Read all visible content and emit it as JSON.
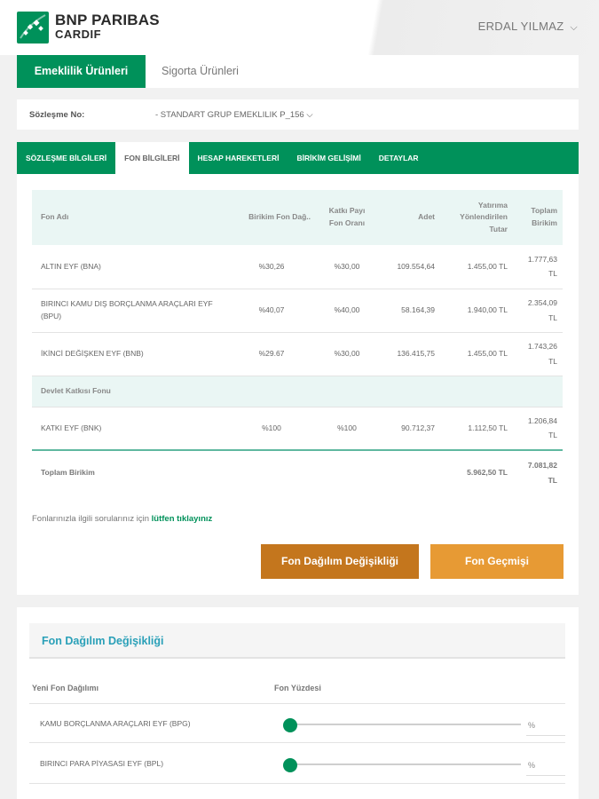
{
  "header": {
    "brand_line1": "BNP PARIBAS",
    "brand_line2": "CARDIF",
    "logo_icon": "bnp-stars-logo-icon",
    "user_name": "ERDAL YILMAZ",
    "user_chevron": "⌵"
  },
  "product_tabs": [
    {
      "label": "Emeklilik Ürünleri",
      "active": true
    },
    {
      "label": "Sigorta Ürünleri",
      "active": false
    }
  ],
  "contract": {
    "label": "Sözleşme No:",
    "value": "- STANDART GRUP EMEKLILIK P_156 ⌵"
  },
  "sub_tabs": [
    {
      "label": "SÖZLEŞME BİLGİLERİ",
      "active": false
    },
    {
      "label": "FON BİLGİLERİ",
      "active": true
    },
    {
      "label": "HESAP HAREKETLERİ",
      "active": false
    },
    {
      "label": "BİRİKİM GELİŞİMİ",
      "active": false
    },
    {
      "label": "DETAYLAR",
      "active": false
    }
  ],
  "fund_table": {
    "headers": {
      "name": "Fon Adı",
      "share": "Birikim Fon Dağ..",
      "contrib_line1": "Katkı Payı",
      "contrib_line2": "Fon Oranı",
      "units": "Adet",
      "invested_line1": "Yatırıma",
      "invested_line2": "Yönlendirilen",
      "invested_line3": "Tutar",
      "total_line1": "Toplam",
      "total_line2": "Birikim"
    },
    "rows": [
      {
        "name": "ALTIN EYF (BNA)",
        "name2": "",
        "share": "%30,26",
        "contrib": "%30,00",
        "units": "109.554,64",
        "invested": "1.455,00 TL",
        "total1": "1.777,63",
        "total2": "TL"
      },
      {
        "name": "BIRINCI KAMU DIŞ BORÇLANMA ARAÇLARI EYF",
        "name2": "(BPU)",
        "share": "%40,07",
        "contrib": "%40,00",
        "units": "58.164,39",
        "invested": "1.940,00 TL",
        "total1": "2.354,09",
        "total2": "TL"
      },
      {
        "name": "İKİNCİ DEĞİŞKEN EYF (BNB)",
        "name2": "",
        "share": "%29.67",
        "contrib": "%30,00",
        "units": "136.415,75",
        "invested": "1.455,00 TL",
        "total1": "1.743,26",
        "total2": "TL"
      }
    ],
    "section_label": "Devlet Katkısı Fonu",
    "state_row": {
      "name": "KATKI EYF (BNK)",
      "share": "%100",
      "contrib": "%100",
      "units": "90.712,37",
      "invested": "1.112,50 TL",
      "total1": "1.206,84",
      "total2": "TL"
    },
    "total": {
      "label": "Toplam Birikim",
      "invested": "5.962,50 TL",
      "total1": "7.081,82",
      "total2": "TL"
    }
  },
  "note": {
    "text": "Fonlarınızla ilgili sorularınız için",
    "link": "lütfen tıklayınız"
  },
  "buttons": {
    "change": "Fon Dağılım Değişikliği",
    "history": "Fon Geçmişi"
  },
  "allocation": {
    "title": "Fon Dağılım Değişikliği",
    "col_name": "Yeni Fon Dağılımı",
    "col_pct": "Fon Yüzdesi",
    "rows": [
      {
        "name": "KAMU BORÇLANMA ARAÇLARI EYF (BPG)",
        "pct_symbol": "%",
        "value": 0
      },
      {
        "name": "BIRINCI PARA PİYASASI EYF (BPL)",
        "pct_symbol": "%",
        "value": 0
      }
    ]
  },
  "colors": {
    "brand_green": "#00915a",
    "button_dark_orange": "#c4761d",
    "button_orange": "#e79a34",
    "title_teal": "#2aa0b8"
  }
}
